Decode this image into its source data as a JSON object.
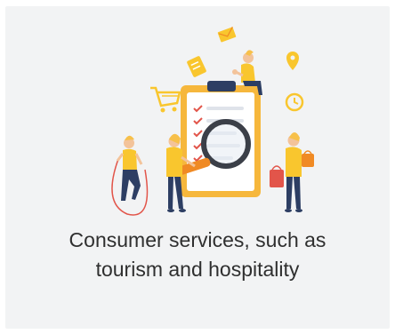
{
  "card": {
    "caption_line1": "Consumer services, such as",
    "caption_line2": "tourism and hospitality",
    "illustration_icon": "consumer-services-illustration"
  },
  "colors": {
    "card_background": "#f2f3f4",
    "accent_yellow": "#f9c62e",
    "accent_orange": "#f08a24",
    "text": "#2f2f2f",
    "skin": "#f3c39a",
    "navy": "#2d3e63",
    "red": "#e2554a"
  }
}
